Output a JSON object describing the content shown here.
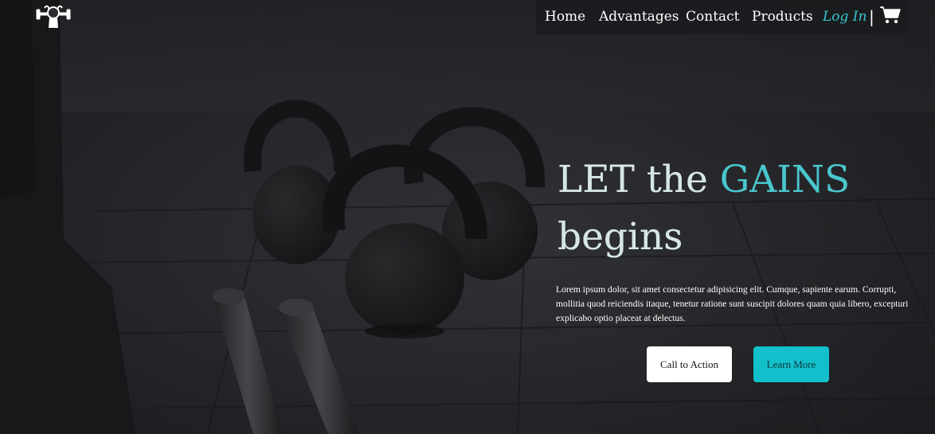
{
  "nav": {
    "links": [
      "Home",
      "Advantages",
      "Contact",
      "Products"
    ],
    "login": "Log In",
    "separator": "|"
  },
  "hero": {
    "headline": {
      "word1": "LET",
      "word2": "the",
      "word3": "GAINS",
      "word4": "begins"
    },
    "description": "Lorem ipsum dolor, sit amet consectetur adipisicing elit. Cumque, sapiente earum. Corrupti, mollitia quod reiciendis itaque, tenetur ratione sunt suscipit dolores quam quia libero, excepturi explicabo optio placeat at delectus.",
    "buttons": {
      "primary": "Call to Action",
      "secondary": "Learn More"
    }
  },
  "colors": {
    "accent": "#11c0cb",
    "login": "#39c6d0",
    "background": "#2b2c30"
  },
  "icons": {
    "logo": "fitness-logo-icon",
    "cart": "shopping-cart-icon"
  }
}
